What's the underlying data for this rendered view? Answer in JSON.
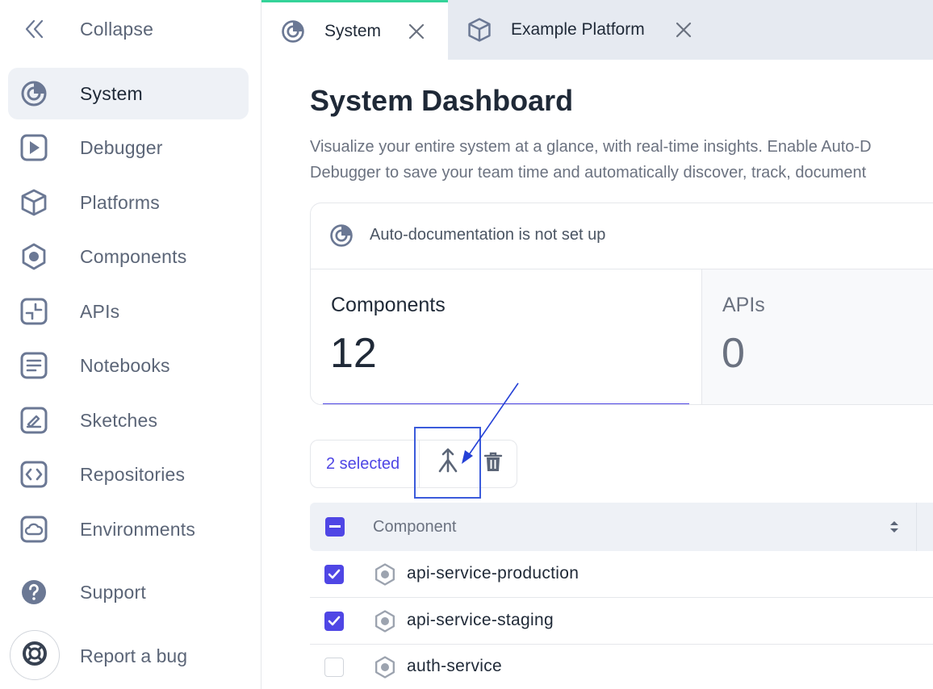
{
  "sidebar": {
    "collapse_label": "Collapse",
    "items": [
      {
        "label": "System",
        "icon": "system-icon",
        "active": true
      },
      {
        "label": "Debugger",
        "icon": "play-icon"
      },
      {
        "label": "Platforms",
        "icon": "cube-icon"
      },
      {
        "label": "Components",
        "icon": "hexagon-icon"
      },
      {
        "label": "APIs",
        "icon": "api-icon"
      },
      {
        "label": "Notebooks",
        "icon": "notebook-icon"
      },
      {
        "label": "Sketches",
        "icon": "sketch-icon"
      },
      {
        "label": "Repositories",
        "icon": "code-icon"
      },
      {
        "label": "Environments",
        "icon": "cloud-icon"
      },
      {
        "label": "Support",
        "icon": "help-icon"
      },
      {
        "label": "Report a bug",
        "icon": "lifebuoy-icon"
      }
    ]
  },
  "tabs": [
    {
      "label": "System",
      "icon": "system-icon",
      "active": true
    },
    {
      "label": "Example Platform",
      "icon": "cube-icon",
      "active": false
    }
  ],
  "main": {
    "title": "System Dashboard",
    "description_line1": "Visualize your entire system at a glance, with real-time insights. Enable Auto-D",
    "description_line2": "Debugger to save your team time and automatically discover, track, document",
    "card": {
      "notice": "Auto-documentation is not set up",
      "stats": [
        {
          "label": "Components",
          "value": "12"
        },
        {
          "label": "APIs",
          "value": "0"
        }
      ]
    },
    "selection": {
      "label": "2 selected"
    },
    "table": {
      "header": "Component",
      "rows": [
        {
          "name": "api-service-production",
          "checked": true
        },
        {
          "name": "api-service-staging",
          "checked": true
        },
        {
          "name": "auth-service",
          "checked": false
        }
      ]
    }
  },
  "colors": {
    "accent": "#4f46e5",
    "tab_indicator": "#34d399",
    "annotation": "#3b5bdb"
  }
}
